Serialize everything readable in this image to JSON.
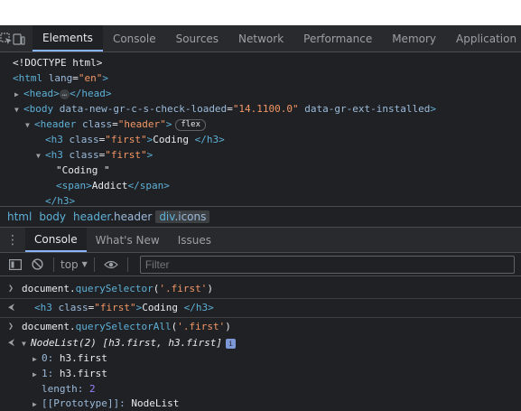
{
  "devtools": {
    "tabs": [
      "Elements",
      "Console",
      "Sources",
      "Network",
      "Performance",
      "Memory",
      "Application"
    ],
    "active_tab": "Elements"
  },
  "elements_tree": {
    "doctype": "<!DOCTYPE html>",
    "html_open": "<html",
    "html_attr": "lang",
    "html_val": "\"en\"",
    "head_open": "<head>",
    "head_close": "</head>",
    "body_open": "<body",
    "body_attr1": "data-new-gr-c-s-check-loaded",
    "body_val1": "\"14.1100.0\"",
    "body_attr2": "data-gr-ext-installed",
    "body_close_bracket": ">",
    "header_open": "<header",
    "class_attr": "class",
    "header_val": "\"header\"",
    "flex_badge": "flex",
    "h3_open": "<h3",
    "first_val": "\"first\"",
    "h3_text": "Coding ",
    "h3_close": "</h3>",
    "coding_text": "\"Coding \"",
    "span_open": "<span>",
    "span_text": "Addict",
    "span_close": "</span>",
    "ellipsis": "…"
  },
  "breadcrumb": {
    "html": "html",
    "body": "body",
    "header_tag": "header",
    "header_cls": ".header",
    "div_tag": "div",
    "div_cls": ".icons"
  },
  "drawer": {
    "tabs": [
      "Console",
      "What's New",
      "Issues"
    ],
    "active_tab": "Console",
    "context": "top",
    "filter_placeholder": "Filter"
  },
  "console": {
    "cmd1_obj": "document.",
    "cmd1_fn": "querySelector",
    "cmd1_arg": "'.first'",
    "out1_open": "<h3",
    "out1_attr": "class",
    "out1_val": "\"first\"",
    "out1_text": "Coding ",
    "out1_close": "</h3>",
    "cmd2_obj": "document.",
    "cmd2_fn": "querySelectorAll",
    "cmd2_arg": "'.first'",
    "nodelist_head": "NodeList(2)",
    "nodelist_preview": "[h3.first, h3.first]",
    "item0_key": "0",
    "item0_val": "h3.first",
    "item1_key": "1",
    "item1_val": "h3.first",
    "length_key": "length",
    "length_val": "2",
    "proto_key": "[[Prototype]]",
    "proto_val": "NodeList"
  },
  "colors": {
    "background": "#202124",
    "tag": "#5db0d7",
    "attribute": "#9bbbdc",
    "string": "#f29766",
    "accent": "#8ab4f8"
  }
}
